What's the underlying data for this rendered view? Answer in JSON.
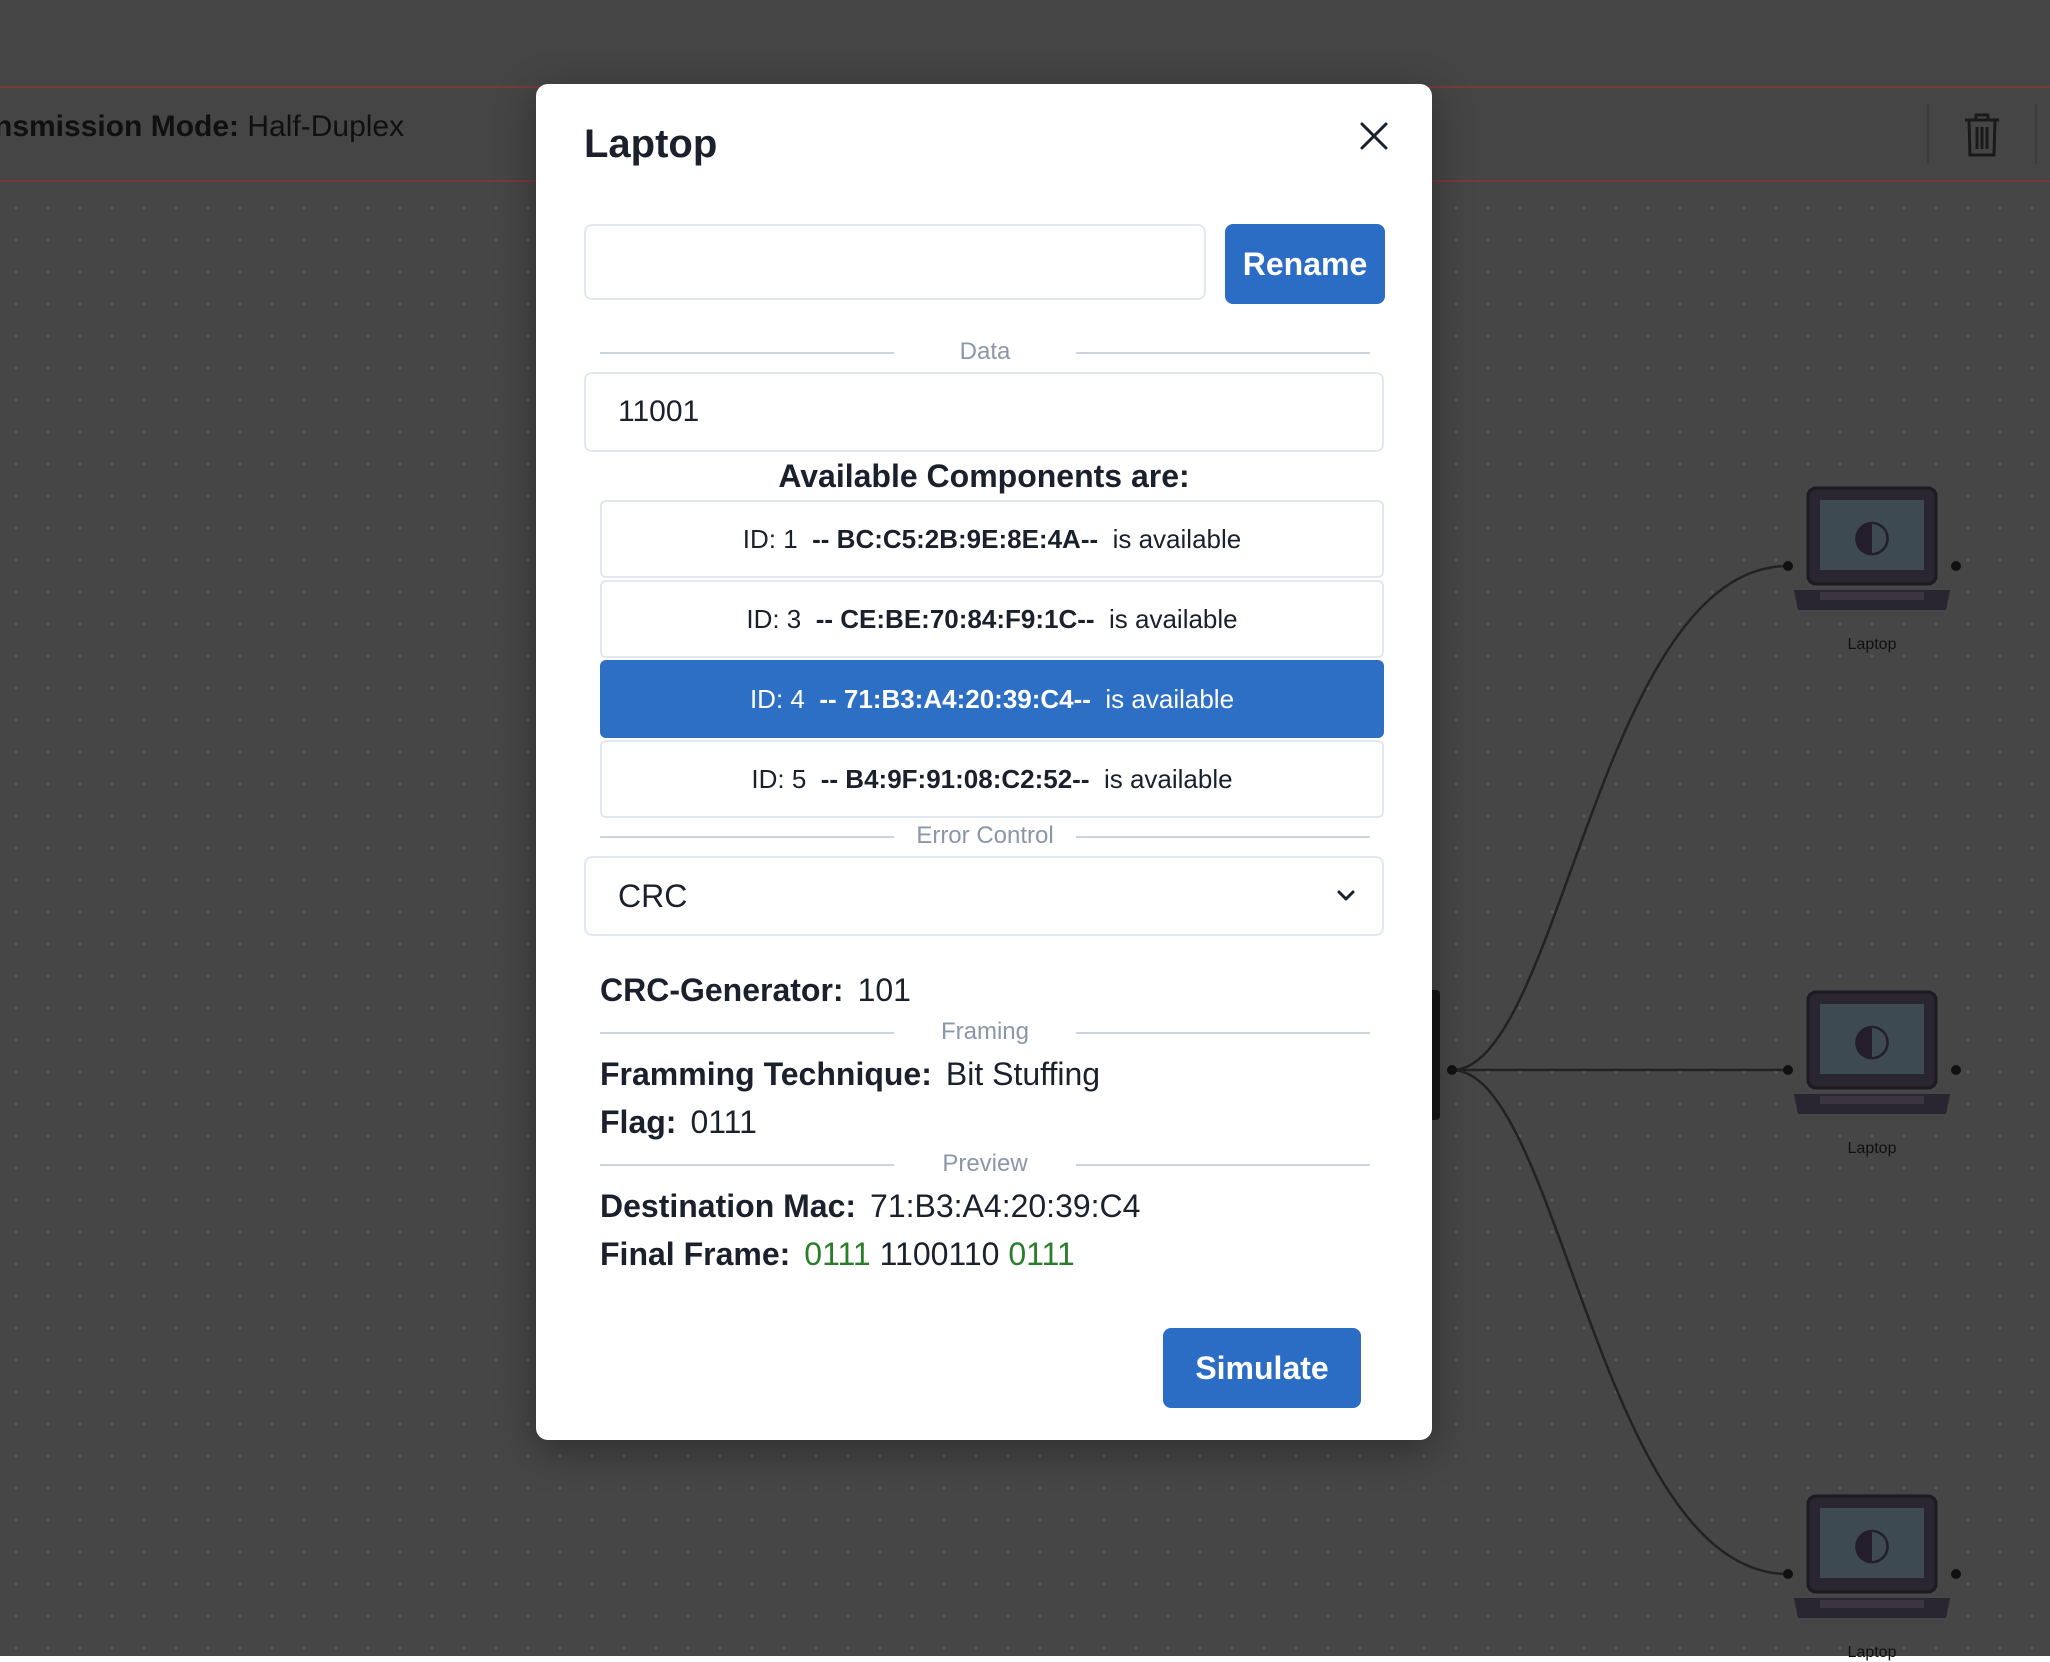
{
  "toolbar": {
    "mode_label": "nsmission Mode:",
    "mode_value": "Half-Duplex"
  },
  "graph": {
    "nodes": [
      {
        "label": "Laptop"
      },
      {
        "label": "Laptop"
      },
      {
        "label": "Laptop"
      }
    ]
  },
  "modal": {
    "title": "Laptop",
    "rename": {
      "input_value": "",
      "button_label": "Rename"
    },
    "data_section_label": "Data",
    "data_value": "11001",
    "components_heading": "Available Components are:",
    "components": [
      {
        "id_text": "ID: 1",
        "mac": "-- BC:C5:2B:9E:8E:4A--",
        "status": "is available",
        "selected": false
      },
      {
        "id_text": "ID: 3",
        "mac": "-- CE:BE:70:84:F9:1C--",
        "status": "is available",
        "selected": false
      },
      {
        "id_text": "ID: 4",
        "mac": "-- 71:B3:A4:20:39:C4--",
        "status": "is available",
        "selected": true
      },
      {
        "id_text": "ID: 5",
        "mac": "-- B4:9F:91:08:C2:52--",
        "status": "is available",
        "selected": false
      }
    ],
    "error_control_label": "Error Control",
    "error_control_value": "CRC",
    "crc_generator_label": "CRC-Generator:",
    "crc_generator_value": "101",
    "framing_label": "Framing",
    "framing_technique_label": "Framming Technique:",
    "framing_technique_value": "Bit Stuffing",
    "flag_label": "Flag:",
    "flag_value": "0111",
    "preview_label": "Preview",
    "destination_mac_label": "Destination Mac:",
    "destination_mac_value": "71:B3:A4:20:39:C4",
    "final_frame_label": "Final Frame:",
    "final_frame_flag_start": "0111",
    "final_frame_payload": "1100110",
    "final_frame_flag_end": "0111",
    "simulate_label": "Simulate"
  },
  "colors": {
    "primary": "#2b6cc4",
    "flag_green": "#2a7d2a",
    "canvas_bg": "#464646"
  }
}
